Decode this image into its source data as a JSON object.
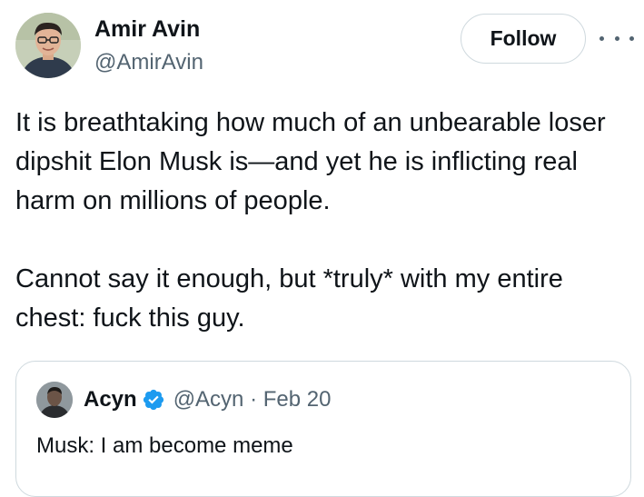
{
  "author": {
    "name": "Amir Avin",
    "handle": "@AmirAvin",
    "avatar_icon": "person-avatar-icon"
  },
  "actions": {
    "follow_label": "Follow",
    "more_icon": "more-horizontal-icon"
  },
  "tweet": {
    "paragraphs": [
      "It is breathtaking how much of an unbearable loser dipshit Elon Musk is—and yet he is inflicting real harm on millions of people.",
      "Cannot say it enough, but *truly* with my entire chest: fuck this guy."
    ]
  },
  "quoted_tweet": {
    "name": "Acyn",
    "verified_icon": "verified-badge-icon",
    "meta": "@Acyn · Feb 20",
    "text": "Musk: I am become meme"
  },
  "colors": {
    "text": "#0f1419",
    "muted": "#536471",
    "border": "#cfd9de",
    "verified": "#1d9bf0"
  }
}
